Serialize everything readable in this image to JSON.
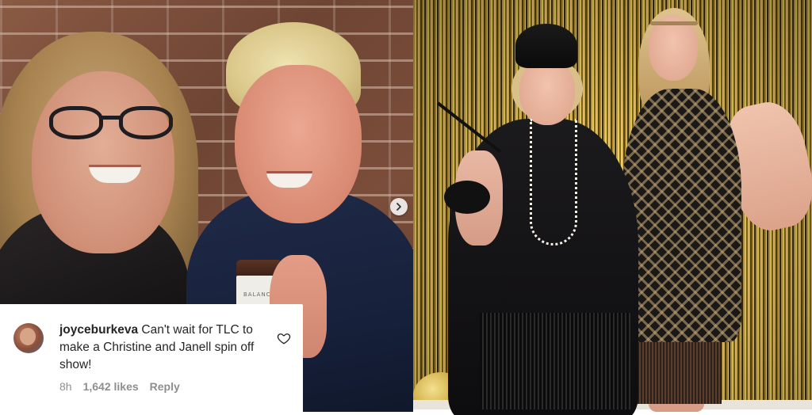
{
  "left_photo": {
    "jar_label": "BALANCE",
    "next_button_icon": "chevron-right-icon"
  },
  "comment": {
    "username": "joyceburkeva",
    "text": "Can't wait for TLC to make a Christine and Janell spin off show!",
    "time": "8h",
    "likes": "1,642 likes",
    "reply_label": "Reply",
    "like_icon": "heart-outline-icon"
  },
  "colors": {
    "text_primary": "#262626",
    "text_secondary": "#8e8e8e",
    "card_background": "#ffffff"
  }
}
